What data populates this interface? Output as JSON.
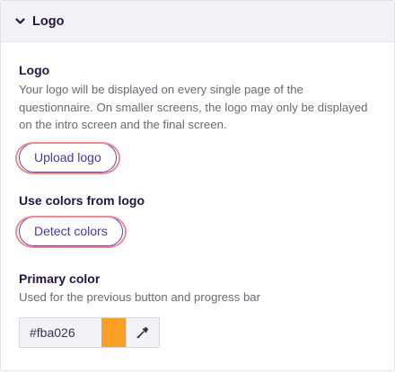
{
  "panel": {
    "title": "Logo",
    "expanded": true
  },
  "logo_section": {
    "label": "Logo",
    "description": "Your logo will be displayed on every single page of the questionnaire. On smaller screens, the logo may only be displayed on the intro screen and the final screen.",
    "upload_button": "Upload logo"
  },
  "colors_section": {
    "label": "Use colors from logo",
    "detect_button": "Detect colors"
  },
  "primary_color": {
    "label": "Primary color",
    "description": "Used for the previous button and progress bar",
    "value": "#fba026",
    "swatch_color": "#fba026"
  },
  "icons": {
    "header_toggle": "chevron-down-icon",
    "color_picker": "eyedropper-icon"
  }
}
